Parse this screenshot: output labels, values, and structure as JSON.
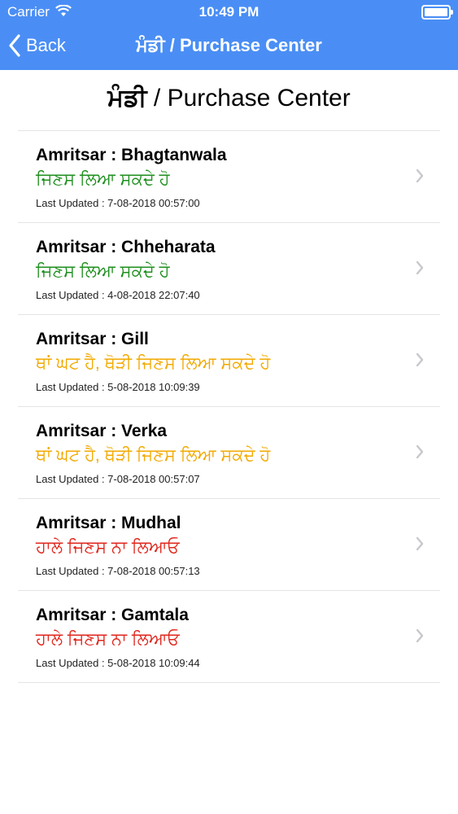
{
  "status_bar": {
    "carrier": "Carrier",
    "time": "10:49 PM"
  },
  "nav": {
    "back_label": "Back",
    "title": "ਮੰਡੀ / Purchase Center"
  },
  "page": {
    "title_pa": "ਮੰਡੀ",
    "title_en": " / Purchase Center"
  },
  "colors": {
    "nav_bg": "#4a8ef5",
    "status_green": "#1e8f1e",
    "status_orange": "#f2a900",
    "status_red": "#e0261c"
  },
  "centers": [
    {
      "title": "Amritsar : Bhagtanwala",
      "status": "ਜਿਣਸ ਲਿਆ ਸਕਦੇ ਹੋ",
      "status_level": "green",
      "updated": "Last Updated : 7-08-2018 00:57:00"
    },
    {
      "title": "Amritsar : Chheharata",
      "status": "ਜਿਣਸ ਲਿਆ ਸਕਦੇ ਹੋ",
      "status_level": "green",
      "updated": "Last Updated : 4-08-2018 22:07:40"
    },
    {
      "title": "Amritsar : Gill",
      "status": "ਥਾਂ ਘਟ ਹੈ, ਥੋੜੀ ਜਿਣਸ ਲਿਆ ਸਕਦੇ ਹੋ",
      "status_level": "orange",
      "updated": "Last Updated : 5-08-2018 10:09:39"
    },
    {
      "title": "Amritsar : Verka",
      "status": "ਥਾਂ ਘਟ ਹੈ, ਥੋੜੀ ਜਿਣਸ ਲਿਆ ਸਕਦੇ ਹੋ",
      "status_level": "orange",
      "updated": "Last Updated : 7-08-2018 00:57:07"
    },
    {
      "title": "Amritsar : Mudhal",
      "status": "ਹਾਲੇ ਜਿਣਸ ਨਾ ਲਿਆਓ",
      "status_level": "red",
      "updated": "Last Updated : 7-08-2018 00:57:13"
    },
    {
      "title": "Amritsar : Gamtala",
      "status": "ਹਾਲੇ ਜਿਣਸ ਨਾ ਲਿਆਓ",
      "status_level": "red",
      "updated": "Last Updated : 5-08-2018 10:09:44"
    }
  ]
}
